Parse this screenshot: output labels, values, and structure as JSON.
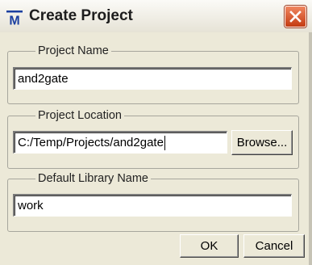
{
  "window": {
    "title": "Create Project",
    "icon": "modelsim-m-icon"
  },
  "project_name": {
    "legend": "Project Name",
    "value": "and2gate"
  },
  "project_location": {
    "legend": "Project Location",
    "value": "C:/Temp/Projects/and2gate",
    "browse_label": "Browse..."
  },
  "default_library": {
    "legend": "Default Library Name",
    "value": "work"
  },
  "buttons": {
    "ok": "OK",
    "cancel": "Cancel"
  },
  "colors": {
    "dialog_bg": "#ece9d8",
    "close_red": "#d9542a",
    "icon_blue": "#1b3fa0"
  }
}
